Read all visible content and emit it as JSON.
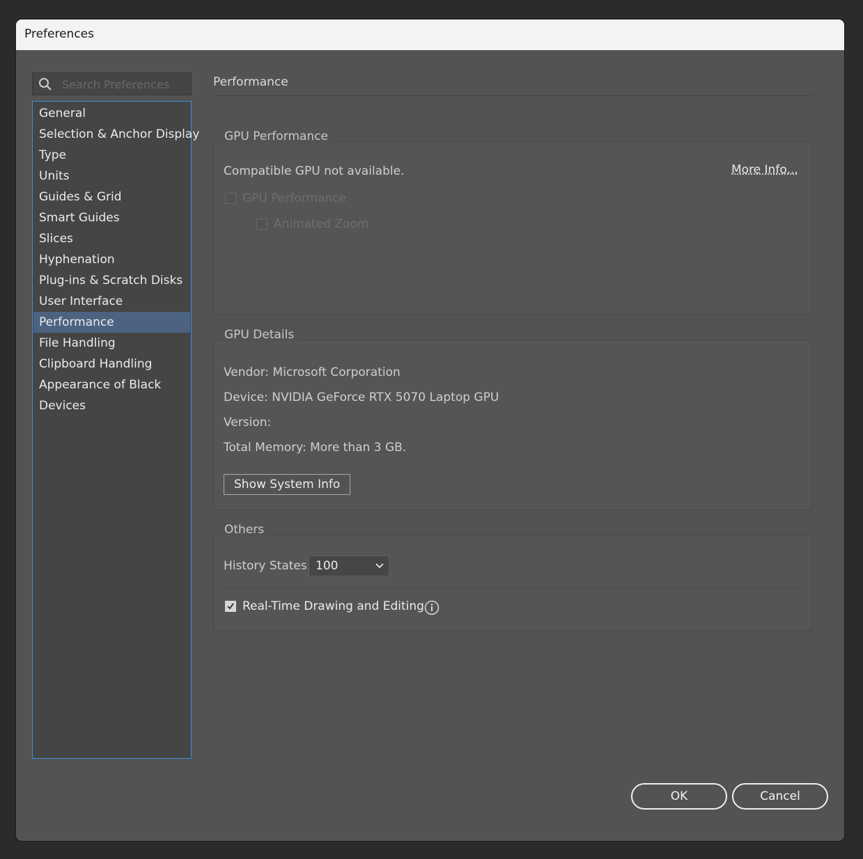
{
  "window": {
    "title": "Preferences"
  },
  "search": {
    "placeholder": "Search Preferences",
    "icon": "search-icon"
  },
  "sidebar": {
    "items": [
      {
        "label": "General"
      },
      {
        "label": "Selection & Anchor Display"
      },
      {
        "label": "Type"
      },
      {
        "label": "Units"
      },
      {
        "label": "Guides & Grid"
      },
      {
        "label": "Smart Guides"
      },
      {
        "label": "Slices"
      },
      {
        "label": "Hyphenation"
      },
      {
        "label": "Plug-ins & Scratch Disks"
      },
      {
        "label": "User Interface"
      },
      {
        "label": "Performance",
        "selected": true
      },
      {
        "label": "File Handling"
      },
      {
        "label": "Clipboard Handling"
      },
      {
        "label": "Appearance of Black"
      },
      {
        "label": "Devices"
      }
    ]
  },
  "page": {
    "title": "Performance",
    "gpu_performance": {
      "group_title": "GPU Performance",
      "status": "Compatible GPU not available.",
      "more_info": "More Info...",
      "gpu_checkbox_label": "GPU Performance",
      "animated_zoom_label": "Animated Zoom"
    },
    "gpu_details": {
      "group_title": "GPU Details",
      "vendor": "Vendor: Microsoft Corporation",
      "device": "Device: NVIDIA GeForce RTX 5070 Laptop GPU",
      "version": "Version:",
      "total_memory": "Total Memory:  More than 3 GB.",
      "show_system_info": "Show System Info"
    },
    "others": {
      "group_title": "Others",
      "history_label": "History States:",
      "history_value": "100",
      "realtime_label": "Real-Time Drawing and Editing",
      "realtime_checked": true
    }
  },
  "buttons": {
    "ok": "OK",
    "cancel": "Cancel"
  },
  "colors": {
    "selection": "#4c6280",
    "focus_border": "#3f8ee0",
    "panel": "#535353"
  }
}
